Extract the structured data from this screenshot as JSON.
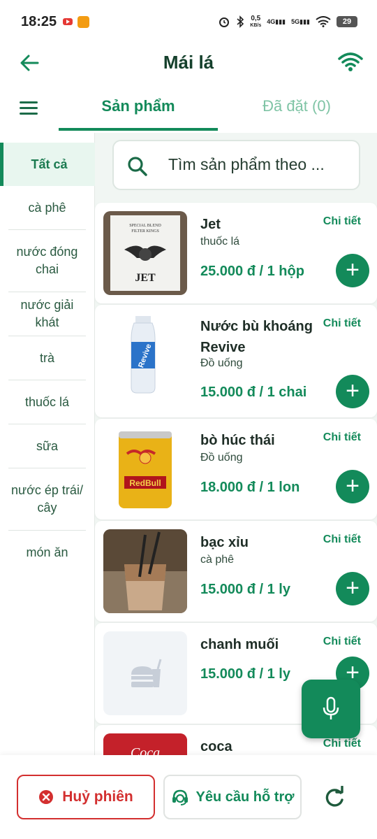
{
  "status_bar": {
    "time": "18:25",
    "speed": "0,5",
    "speed_unit": "KB/s",
    "net1": "4G",
    "net2": "5G",
    "battery": "29"
  },
  "header": {
    "title": "Mái lá",
    "back_icon": "arrow-left-icon",
    "wifi_icon": "wifi-icon"
  },
  "tabs": {
    "products": "Sản phẩm",
    "ordered": "Đã đặt (0)"
  },
  "categories": [
    "Tất cả",
    "cà phê",
    "nước đóng chai",
    "nước giải khát",
    "trà",
    "thuốc lá",
    "sữa",
    "nước ép trái/ cây",
    "món ăn"
  ],
  "search": {
    "placeholder": "Tìm sản phẩm theo ..."
  },
  "products": [
    {
      "name": "Jet",
      "category": "thuốc lá",
      "price": "25.000 đ / 1 hộp",
      "detail": "Chi tiết"
    },
    {
      "name": "Nước bù khoáng Revive",
      "category": "Đồ uống",
      "price": "15.000 đ / 1 chai",
      "detail": "Chi tiết"
    },
    {
      "name": "bò húc thái",
      "category": "Đồ uống",
      "price": "18.000 đ / 1 lon",
      "detail": "Chi tiết"
    },
    {
      "name": "bạc xỉu",
      "category": "cà phê",
      "price": "15.000 đ / 1 ly",
      "detail": "Chi tiết"
    },
    {
      "name": "chanh muối",
      "category": "",
      "price": "15.000 đ / 1 ly",
      "detail": "Chi tiết"
    },
    {
      "name": "coca",
      "category": "",
      "price": "",
      "detail": "Chi tiết"
    }
  ],
  "bottom": {
    "cancel": "Huỷ phiên",
    "support": "Yêu cầu hỗ trợ"
  },
  "colors": {
    "accent": "#138a5a",
    "danger": "#d32f2f"
  }
}
